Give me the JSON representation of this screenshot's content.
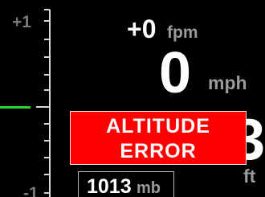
{
  "vertical_speed_scale": {
    "top_label": "+1",
    "bottom_label": "-1"
  },
  "vertical_speed": {
    "value": "+0",
    "unit": "fpm"
  },
  "airspeed": {
    "value": "0",
    "unit": "mph"
  },
  "altitude": {
    "value_visible": "3",
    "unit": "ft"
  },
  "alert": {
    "line1": "ALTITUDE",
    "line2": "ERROR"
  },
  "barometer": {
    "value": "1013",
    "unit": "mb"
  },
  "colors": {
    "background": "#000000",
    "alert": "#ff0000",
    "rate_indicator": "#2bd62b",
    "units": "#9a9a9a",
    "scale": "#7a7a7a"
  }
}
